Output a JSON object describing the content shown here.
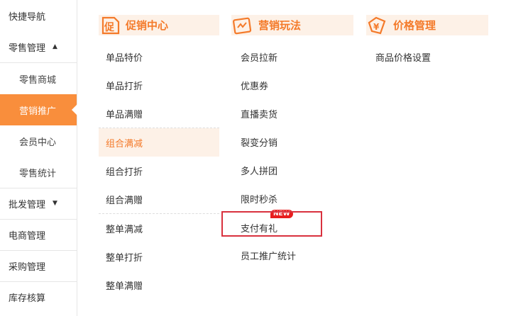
{
  "sidebar": {
    "quick_nav": "快捷导航",
    "retail": "零售管理",
    "retail_sub": [
      "零售商城",
      "营销推广",
      "会员中心",
      "零售统计"
    ],
    "wholesale": "批发管理",
    "ecommerce": "电商管理",
    "purchase": "采购管理",
    "inventory": "库存核算",
    "active_item": "营销推广",
    "accent_color": "#f98e3c"
  },
  "columns": {
    "promo": {
      "title": "促销中心",
      "icon": "promo-center-icon",
      "items": [
        "单品特价",
        "单品打折",
        "单品满赠",
        "组合满减",
        "组合打折",
        "组合满赠",
        "整单满减",
        "整单打折",
        "整单满赠"
      ],
      "highlighted": "组合满减"
    },
    "marketing": {
      "title": "营销玩法",
      "icon": "marketing-play-icon",
      "items": [
        "会员拉新",
        "优惠券",
        "直播卖货",
        "裂变分销",
        "多人拼团",
        "限时秒杀",
        "支付有礼",
        "员工推广统计"
      ],
      "new_badge": "NEW"
    },
    "price": {
      "title": "价格管理",
      "icon": "price-management-icon",
      "items": [
        "商品价格设置"
      ]
    }
  }
}
